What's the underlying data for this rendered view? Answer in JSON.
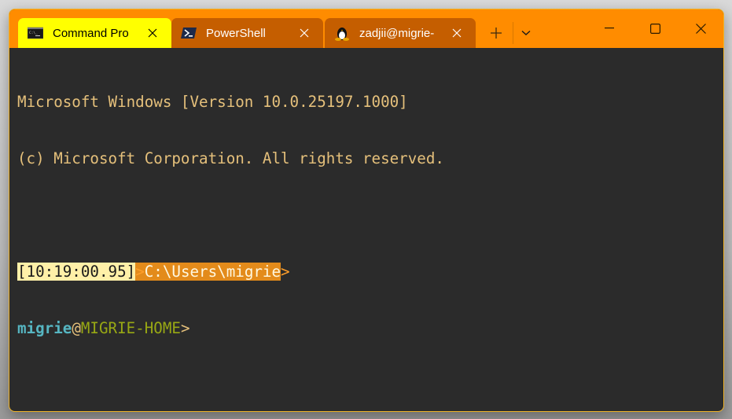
{
  "tabs": [
    {
      "label": "Command Pro",
      "icon": "cmd-icon",
      "active": true
    },
    {
      "label": "PowerShell",
      "icon": "powershell-icon",
      "active": false
    },
    {
      "label": "zadjii@migrie-",
      "icon": "linux-penguin-icon",
      "active": false
    }
  ],
  "toolbar": {
    "new_tab": "+",
    "dropdown": "⌄"
  },
  "window_controls": {
    "minimize": "–",
    "maximize": "☐",
    "close": "✕"
  },
  "terminal": {
    "banner_line1": "Microsoft Windows [Version 10.0.25197.1000]",
    "banner_line2": "(c) Microsoft Corporation. All rights reserved.",
    "prompt_timestamp": "[10:19:00.95]",
    "prompt_arrow1": ">",
    "prompt_path": "C:\\Users\\migrie",
    "prompt_arrow_end": ">",
    "user": "migrie",
    "at": "@",
    "host": "MIGRIE-HOME",
    "prompt_arrow2": ">"
  },
  "colors": {
    "titlebar": "#ff8c00",
    "active_tab": "#ffff00",
    "inactive_tab": "#c55e00",
    "terminal_bg": "#2b2b2b",
    "border": "#f0b429"
  }
}
